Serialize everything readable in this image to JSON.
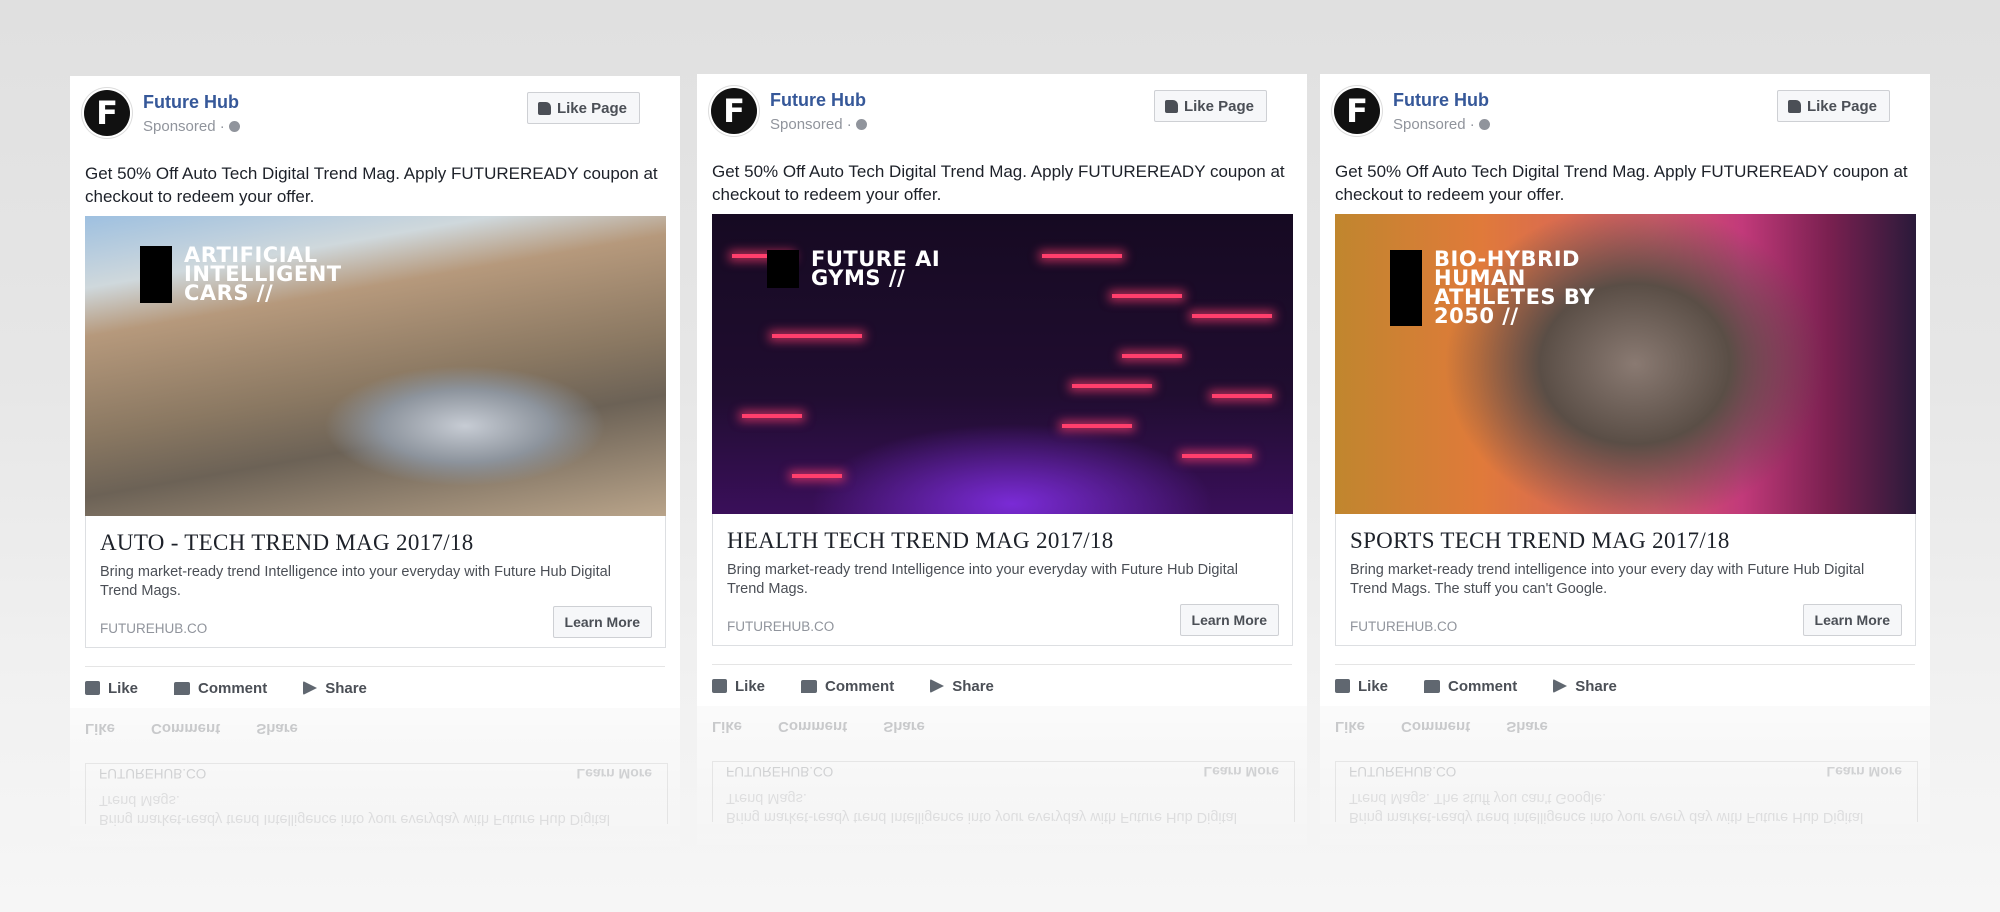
{
  "cards": [
    {
      "page_name": "Future Hub",
      "sponsored": "Sponsored ·",
      "like_page": "Like Page",
      "post_text": "Get 50% Off Auto Tech Digital Trend Mag. Apply FUTUREREADY coupon at checkout to redeem your offer.",
      "image_text": "ARTIFICIAL INTELLIGENT CARS //",
      "ad_title": "AUTO - TECH TREND MAG 2017/18",
      "ad_desc": "Bring market-ready trend Intelligence into your everyday with Future Hub Digital Trend Mags.",
      "domain": "FUTUREHUB.CO",
      "learn_more": "Learn More",
      "actions": {
        "like": "Like",
        "comment": "Comment",
        "share": "Share"
      }
    },
    {
      "page_name": "Future Hub",
      "sponsored": "Sponsored ·",
      "like_page": "Like Page",
      "post_text": "Get 50% Off Auto Tech Digital Trend Mag. Apply FUTUREREADY coupon at checkout to redeem your offer.",
      "image_text": "FUTURE AI GYMS //",
      "ad_title": "HEALTH TECH TREND MAG 2017/18",
      "ad_desc": "Bring market-ready trend Intelligence into your everyday with Future Hub Digital Trend Mags.",
      "domain": "FUTUREHUB.CO",
      "learn_more": "Learn More",
      "actions": {
        "like": "Like",
        "comment": "Comment",
        "share": "Share"
      }
    },
    {
      "page_name": "Future Hub",
      "sponsored": "Sponsored ·",
      "like_page": "Like Page",
      "post_text": "Get 50% Off Auto Tech Digital Trend Mag. Apply FUTUREREADY coupon at checkout to redeem your offer.",
      "image_text": "BIO-HYBRID HUMAN ATHLETES BY 2050 //",
      "ad_title": "SPORTS TECH TREND MAG 2017/18",
      "ad_desc": "Bring market-ready trend intelligence into your every day with Future Hub Digital Trend Mags. The stuff you can't Google.",
      "domain": "FUTUREHUB.CO",
      "learn_more": "Learn More",
      "actions": {
        "like": "Like",
        "comment": "Comment",
        "share": "Share"
      }
    }
  ],
  "logo_letter": "F",
  "colors": {
    "page_name": "#365899",
    "secondary_text": "#90949c",
    "background": "#e4e4e4"
  }
}
